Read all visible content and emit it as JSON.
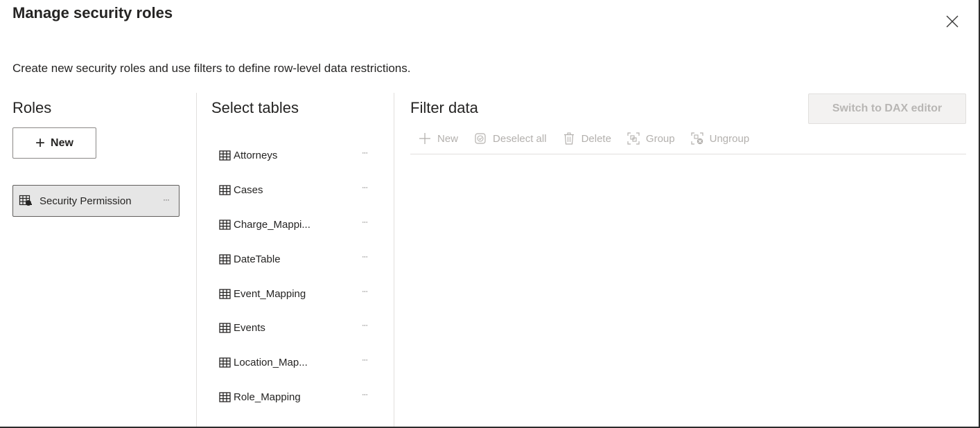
{
  "dialog": {
    "title": "Manage security roles",
    "description": "Create new security roles and use filters to define row-level data restrictions."
  },
  "roles": {
    "heading": "Roles",
    "new_label": "New",
    "items": [
      {
        "label": "Security Permission",
        "more": "···"
      }
    ]
  },
  "tables": {
    "heading": "Select tables",
    "items": [
      {
        "label": "Attorneys",
        "more": "···"
      },
      {
        "label": "Cases",
        "more": "···"
      },
      {
        "label": "Charge_Mappi...",
        "more": "···"
      },
      {
        "label": "DateTable",
        "more": "···"
      },
      {
        "label": "Event_Mapping",
        "more": "···"
      },
      {
        "label": "Events",
        "more": "···"
      },
      {
        "label": "Location_Map...",
        "more": "···"
      },
      {
        "label": "Role_Mapping",
        "more": "···"
      }
    ]
  },
  "filter": {
    "heading": "Filter data",
    "dax_button": "Switch to DAX editor",
    "toolbar": {
      "new": "New",
      "deselect_all": "Deselect all",
      "delete": "Delete",
      "group": "Group",
      "ungroup": "Ungroup"
    }
  }
}
